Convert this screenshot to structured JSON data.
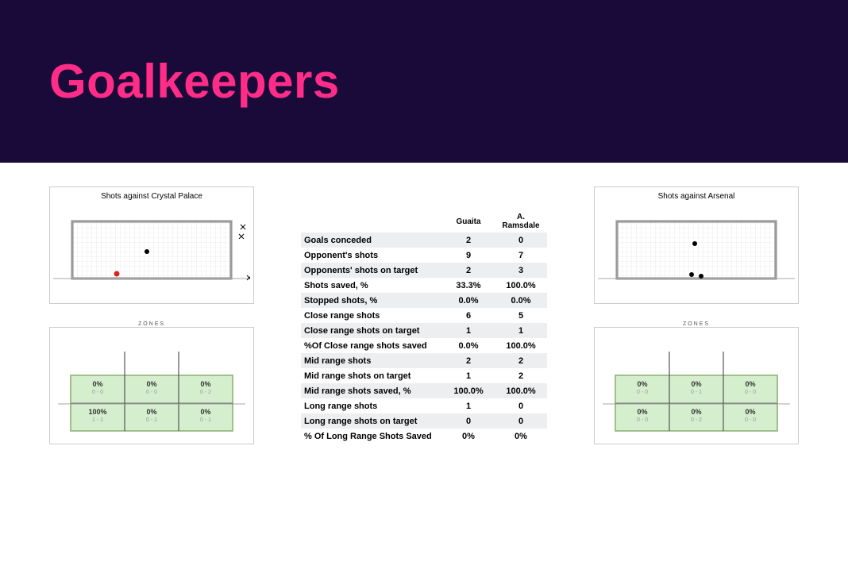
{
  "title": "Goalkeepers",
  "left": {
    "panel_title": "Shots against Crystal Palace",
    "zones_label": "ZONES",
    "zones": [
      [
        {
          "pct": "0%",
          "sub": "0 - 0"
        },
        {
          "pct": "0%",
          "sub": "0 - 0"
        },
        {
          "pct": "0%",
          "sub": "0 - 2"
        }
      ],
      [
        {
          "pct": "100%",
          "sub": "1 - 1"
        },
        {
          "pct": "0%",
          "sub": "0 - 1"
        },
        {
          "pct": "0%",
          "sub": "0 - 1"
        }
      ]
    ]
  },
  "right": {
    "panel_title": "Shots against Arsenal",
    "zones_label": "ZONES",
    "zones": [
      [
        {
          "pct": "0%",
          "sub": "0 - 0"
        },
        {
          "pct": "0%",
          "sub": "0 - 1"
        },
        {
          "pct": "0%",
          "sub": "0 - 0"
        }
      ],
      [
        {
          "pct": "0%",
          "sub": "0 - 0"
        },
        {
          "pct": "0%",
          "sub": "0 - 2"
        },
        {
          "pct": "0%",
          "sub": "0 - 0"
        }
      ]
    ]
  },
  "table": {
    "headers": [
      "",
      "Guaita",
      "A. Ramsdale"
    ],
    "rows": [
      {
        "metric": "Goals conceded",
        "a": "2",
        "b": "0"
      },
      {
        "metric": "Opponent's shots",
        "a": "9",
        "b": "7"
      },
      {
        "metric": "Opponents' shots  on target",
        "a": "2",
        "b": "3"
      },
      {
        "metric": "Shots saved, %",
        "a": "33.3%",
        "b": "100.0%"
      },
      {
        "metric": "Stopped shots, %",
        "a": "0.0%",
        "b": "0.0%"
      },
      {
        "metric": "Close range shots",
        "a": "6",
        "b": "5"
      },
      {
        "metric": "Close range shots on target",
        "a": "1",
        "b": "1"
      },
      {
        "metric": "%Of Close range shots saved",
        "a": "0.0%",
        "b": "100.0%"
      },
      {
        "metric": "Mid range shots",
        "a": "2",
        "b": "2"
      },
      {
        "metric": "Mid range shots on target",
        "a": "1",
        "b": "2"
      },
      {
        "metric": "Mid range shots saved, %",
        "a": "100.0%",
        "b": "100.0%"
      },
      {
        "metric": "Long range shots",
        "a": "1",
        "b": "0"
      },
      {
        "metric": "Long range shots on target",
        "a": "0",
        "b": "0"
      },
      {
        "metric": "% Of Long Range Shots Saved",
        "a": "0%",
        "b": "0%"
      }
    ]
  },
  "chart_data": [
    {
      "type": "scatter",
      "title": "Shots against Crystal Palace",
      "goal_width": 200,
      "goal_height": 70,
      "points": [
        {
          "x": 0.47,
          "y": 0.55,
          "kind": "shot"
        },
        {
          "x": 0.28,
          "y": 0.95,
          "kind": "goal"
        },
        {
          "x": 1.07,
          "y": 0.08,
          "kind": "miss"
        },
        {
          "x": 1.05,
          "y": 0.22,
          "kind": "miss"
        },
        {
          "x": 1.15,
          "y": 0.95,
          "kind": "miss"
        }
      ]
    },
    {
      "type": "table",
      "title": "Zones — Shots against Crystal Palace",
      "rows": 2,
      "cols": 3,
      "cells": [
        {
          "row": 0,
          "col": 0,
          "pct": 0,
          "made": 0,
          "att": 0
        },
        {
          "row": 0,
          "col": 1,
          "pct": 0,
          "made": 0,
          "att": 0
        },
        {
          "row": 0,
          "col": 2,
          "pct": 0,
          "made": 0,
          "att": 2
        },
        {
          "row": 1,
          "col": 0,
          "pct": 100,
          "made": 1,
          "att": 1
        },
        {
          "row": 1,
          "col": 1,
          "pct": 0,
          "made": 0,
          "att": 1
        },
        {
          "row": 1,
          "col": 2,
          "pct": 0,
          "made": 0,
          "att": 1
        }
      ]
    },
    {
      "type": "scatter",
      "title": "Shots against Arsenal",
      "goal_width": 200,
      "goal_height": 70,
      "points": [
        {
          "x": 0.49,
          "y": 0.4,
          "kind": "shot"
        },
        {
          "x": 0.47,
          "y": 0.94,
          "kind": "shot"
        },
        {
          "x": 0.53,
          "y": 0.96,
          "kind": "shot"
        }
      ]
    },
    {
      "type": "table",
      "title": "Zones — Shots against Arsenal",
      "rows": 2,
      "cols": 3,
      "cells": [
        {
          "row": 0,
          "col": 0,
          "pct": 0,
          "made": 0,
          "att": 0
        },
        {
          "row": 0,
          "col": 1,
          "pct": 0,
          "made": 0,
          "att": 1
        },
        {
          "row": 0,
          "col": 2,
          "pct": 0,
          "made": 0,
          "att": 0
        },
        {
          "row": 1,
          "col": 0,
          "pct": 0,
          "made": 0,
          "att": 0
        },
        {
          "row": 1,
          "col": 1,
          "pct": 0,
          "made": 0,
          "att": 2
        },
        {
          "row": 1,
          "col": 2,
          "pct": 0,
          "made": 0,
          "att": 0
        }
      ]
    },
    {
      "type": "table",
      "title": "Goalkeeper comparison",
      "categories": [
        "Goals conceded",
        "Opponent's shots",
        "Opponents' shots on target",
        "Shots saved, %",
        "Stopped shots, %",
        "Close range shots",
        "Close range shots on target",
        "%Of Close range shots saved",
        "Mid range shots",
        "Mid range shots on target",
        "Mid range shots saved, %",
        "Long range shots",
        "Long range shots on target",
        "% Of Long Range Shots Saved"
      ],
      "series": [
        {
          "name": "Guaita",
          "values": [
            2,
            9,
            2,
            33.3,
            0.0,
            6,
            1,
            0.0,
            2,
            1,
            100.0,
            1,
            0,
            0
          ]
        },
        {
          "name": "A. Ramsdale",
          "values": [
            0,
            7,
            3,
            100.0,
            0.0,
            5,
            1,
            100.0,
            2,
            2,
            100.0,
            0,
            0,
            0
          ]
        }
      ]
    }
  ]
}
